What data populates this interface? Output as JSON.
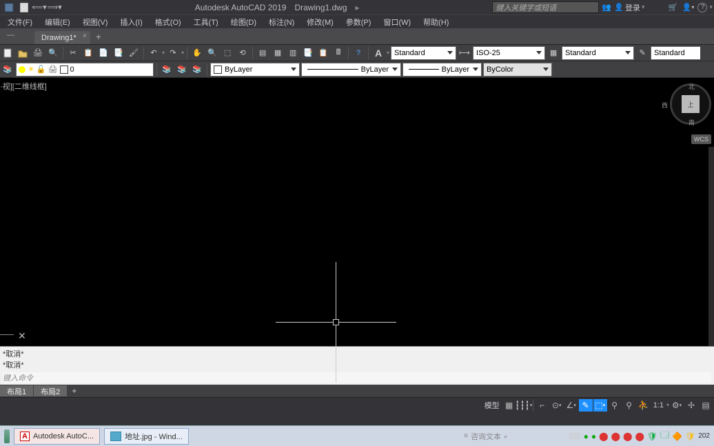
{
  "app": {
    "title": "Autodesk AutoCAD 2019",
    "filename": "Drawing1.dwg",
    "search_placeholder": "键入关键字或短语",
    "login_label": "登录"
  },
  "menus": [
    "文件(F)",
    "编辑(E)",
    "视图(V)",
    "插入(I)",
    "格式(O)",
    "工具(T)",
    "绘图(D)",
    "标注(N)",
    "修改(M)",
    "参数(P)",
    "窗口(W)",
    "帮助(H)"
  ],
  "doc_tab": "Drawing1*",
  "styles": {
    "text_style": "Standard",
    "dim_style": "ISO-25",
    "table_style": "Standard",
    "style4": "Standard"
  },
  "layer": {
    "name": "0",
    "color_dd": "ByLayer",
    "linetype_dd": "ByLayer",
    "lineweight_dd": "ByLayer",
    "plot_style": "ByColor"
  },
  "view_label": "·视][二维线框]",
  "viewcube": {
    "north": "北",
    "south": "南",
    "west": "西",
    "top": "上",
    "wcs": "WCS"
  },
  "command": {
    "history": [
      "*取消*",
      "*取消*"
    ],
    "prompt": "键入命令"
  },
  "layout_tabs": [
    "布局1",
    "布局2"
  ],
  "status": {
    "model": "模型",
    "scale": "1:1",
    "tray_text": "咨询文本"
  },
  "taskbar": {
    "app1": "Autodesk AutoC...",
    "app2": "地址.jpg - Wind...",
    "year": "202"
  }
}
